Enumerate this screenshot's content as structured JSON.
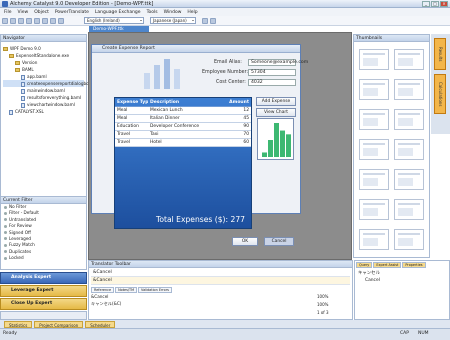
{
  "app": {
    "title": "Alchemy Catalyst 9.0 Developer Edition - [Demo-WPF.ttk]"
  },
  "menu": [
    "File",
    "View",
    "Object",
    "PowerTranslate",
    "Language Exchange",
    "Tools",
    "Window",
    "Help"
  ],
  "toolbar": {
    "source_lang": "English (Ireland)",
    "target_lang": "Japanese (Japan)"
  },
  "navigator": {
    "title": "Navigator",
    "tree": [
      {
        "label": "WPF Demo 9.0",
        "level": 0,
        "kind": "folder"
      },
      {
        "label": "ExpenseItStandalone.exe",
        "level": 1,
        "kind": "folder"
      },
      {
        "label": "Version",
        "level": 2,
        "kind": "folder"
      },
      {
        "label": "BAML",
        "level": 2,
        "kind": "folder"
      },
      {
        "label": "app.baml",
        "level": 3,
        "kind": "doc"
      },
      {
        "label": "createexpensereportdialogbox.baml",
        "level": 3,
        "kind": "doc"
      },
      {
        "label": "mainwindow.baml",
        "level": 3,
        "kind": "doc"
      },
      {
        "label": "resultsforeverything.baml",
        "level": 3,
        "kind": "doc"
      },
      {
        "label": "viewchartwindow.baml",
        "level": 3,
        "kind": "doc"
      },
      {
        "label": "CATALYST.XSL",
        "level": 1,
        "kind": "doc"
      }
    ]
  },
  "filter": {
    "title": "Current Filter",
    "items": [
      "No Filter",
      "Filter - Default",
      "Untranslated",
      "For Review",
      "Signed Off",
      "Leveraged",
      "Fuzzy Match",
      "Duplicates",
      "Locked"
    ]
  },
  "experts": [
    "Analysis Expert",
    "Leverage Expert",
    "Close Up Expert"
  ],
  "document_tab": "Demo-WPF.ttk",
  "dialog": {
    "title": "Create Expense Report",
    "email_label": "Email Alias:",
    "email_value": "Someone@example.com",
    "employee_label": "Employee Number:",
    "employee_value": "57304",
    "cost_label": "Cost Center:",
    "cost_value": "4032",
    "columns": [
      "Expense Type",
      "Description",
      "Amount"
    ],
    "rows": [
      [
        "Meal",
        "Mexican Lunch",
        "12"
      ],
      [
        "Meal",
        "Italian Dinner",
        "45"
      ],
      [
        "Education",
        "Developer Conference",
        "90"
      ],
      [
        "Travel",
        "Taxi",
        "70"
      ],
      [
        "Travel",
        "Hotel",
        "60"
      ]
    ],
    "total_label": "Total Expenses ($):",
    "total_value": "277",
    "add_expense": "Add Expense",
    "view_chart": "View Chart",
    "ok": "OK",
    "cancel": "Cancel"
  },
  "chart_data": {
    "type": "bar",
    "categories": [
      "Mexican Lunch",
      "Italian Dinner",
      "Developer Conference",
      "Taxi",
      "Hotel"
    ],
    "values": [
      12,
      45,
      90,
      70,
      60
    ]
  },
  "thumbnails": {
    "title": "Thumbnails"
  },
  "right_tabs": [
    "Results",
    "Calculations"
  ],
  "translator": {
    "title": "Translator Toolbar",
    "source": "&Cancel",
    "target": "&Cancel",
    "memo_tabs": [
      "Reference",
      "Notes/TM",
      "Validation Errors"
    ],
    "bottom_source": "&Cancel",
    "bottom_target": "キャンセル(&C)",
    "match": "100%",
    "match2": "100%",
    "page": "1 of 3"
  },
  "qa": {
    "tabs": [
      "Query",
      "Expert Assist",
      "Properties"
    ],
    "line1": "キャンセル",
    "line2": "Cancel"
  },
  "status_tabs": [
    "Statistics",
    "Project Comparison",
    "Scheduler"
  ],
  "status": {
    "ready": "Ready",
    "caps": "CAP",
    "num": "NUM"
  },
  "colors": {
    "accent": "#3a68b8",
    "expert": "#e5b946",
    "tab": "#f3b64a"
  }
}
